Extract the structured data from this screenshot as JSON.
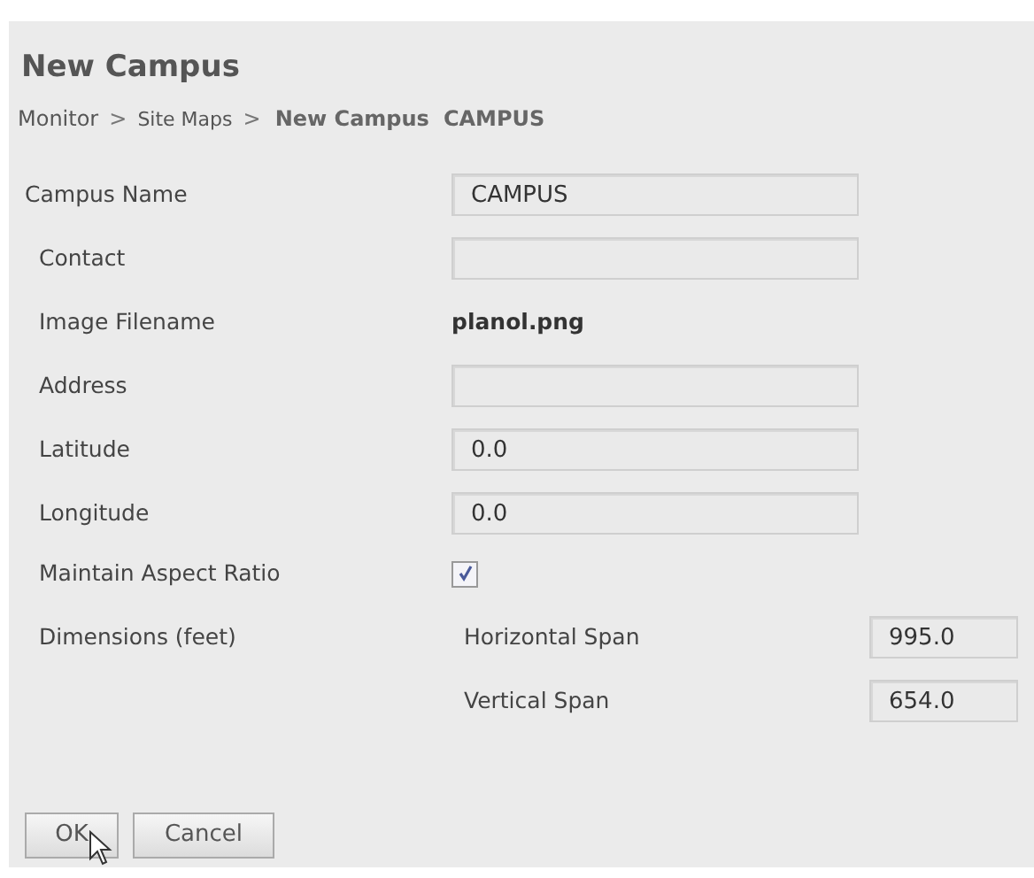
{
  "title": "New Campus",
  "breadcrumb": [
    {
      "kind": "link",
      "label": "Monitor"
    },
    {
      "kind": "separator",
      "label": ">"
    },
    {
      "kind": "link",
      "label": "Site Maps"
    },
    {
      "kind": "separator",
      "label": ">"
    },
    {
      "kind": "current",
      "label": "New Campus"
    },
    {
      "kind": "current",
      "label": "CAMPUS"
    }
  ],
  "fields": [
    {
      "kind": "input",
      "label": "Campus Name",
      "value": "CAMPUS"
    },
    {
      "kind": "input",
      "label": "Contact"
    },
    {
      "kind": "text",
      "label": "Image Filename",
      "value": "planol.png"
    },
    {
      "kind": "input",
      "label": "Address"
    },
    {
      "kind": "input",
      "label": "Latitude",
      "value": "0.0"
    },
    {
      "kind": "input",
      "label": "Longitude",
      "value": "0.0"
    },
    {
      "kind": "checkbox",
      "label": "Maintain Aspect Ratio",
      "checked": true
    },
    {
      "kind": "dimensions",
      "label": "Dimensions (feet)",
      "spans": [
        {
          "label": "Horizontal Span",
          "value": "995.0"
        },
        {
          "label": "Vertical Span",
          "value": "654.0"
        }
      ]
    }
  ],
  "buttons": [
    "OK",
    "Cancel"
  ]
}
